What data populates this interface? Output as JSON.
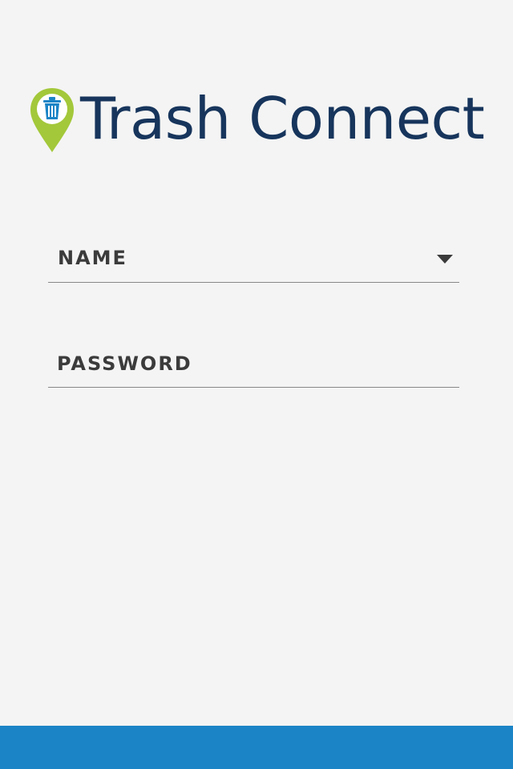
{
  "app": {
    "name": "Trash Connect"
  },
  "form": {
    "name_field": {
      "placeholder": "NAME",
      "icon": "chevron-down-icon"
    },
    "password_field": {
      "placeholder": "PASSWORD"
    }
  },
  "colors": {
    "background": "#f4f4f4",
    "brand_text": "#17355c",
    "pin_green": "#a3c83a",
    "pin_blue": "#1b84c6",
    "footer": "#1b84c6",
    "field_text": "#3b3b3b",
    "underline": "#888888"
  }
}
